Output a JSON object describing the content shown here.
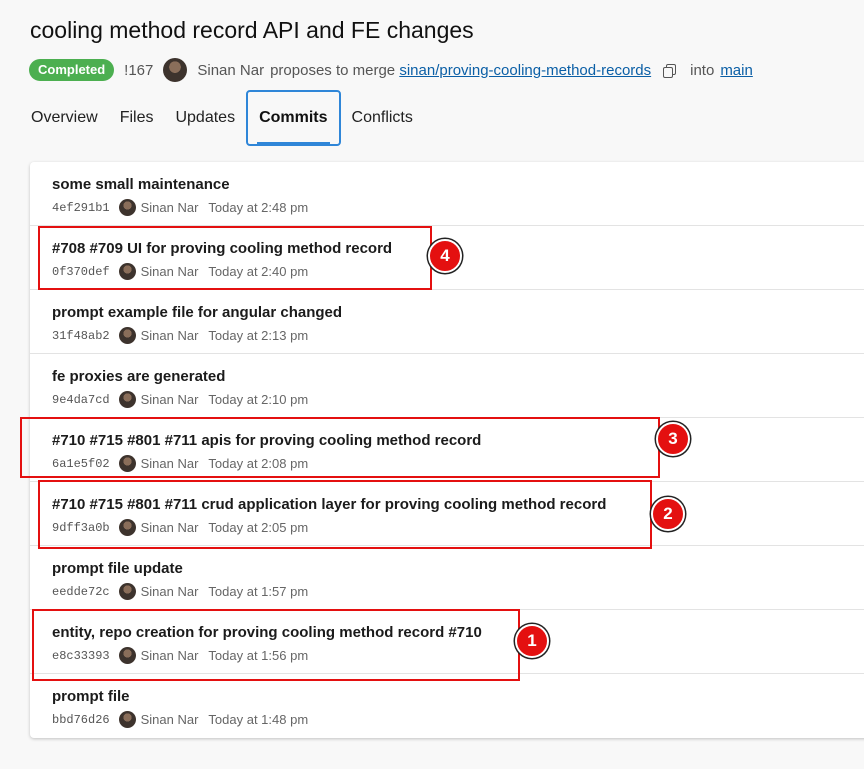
{
  "page": {
    "title": "cooling method record API and FE changes",
    "status": "Completed",
    "pr_id": "!167",
    "author": "Sinan Nar",
    "proposes_text": "proposes to merge",
    "source_branch": "sinan/proving-cooling-method-records",
    "into_text": "into",
    "target_branch": "main"
  },
  "tabs": [
    "Overview",
    "Files",
    "Updates",
    "Commits",
    "Conflicts"
  ],
  "active_tab": "Commits",
  "commits": [
    {
      "message": "some small maintenance",
      "hash": "4ef291b1",
      "author": "Sinan Nar",
      "time": "Today at 2:48 pm"
    },
    {
      "message": "#708 #709 UI for proving cooling method record",
      "hash": "0f370def",
      "author": "Sinan Nar",
      "time": "Today at 2:40 pm"
    },
    {
      "message": "prompt example file for angular changed",
      "hash": "31f48ab2",
      "author": "Sinan Nar",
      "time": "Today at 2:13 pm"
    },
    {
      "message": "fe proxies are generated",
      "hash": "9e4da7cd",
      "author": "Sinan Nar",
      "time": "Today at 2:10 pm"
    },
    {
      "message": "#710 #715 #801 #711 apis for proving cooling method record",
      "hash": "6a1e5f02",
      "author": "Sinan Nar",
      "time": "Today at 2:08 pm"
    },
    {
      "message": "#710 #715 #801 #711 crud application layer for proving cooling method record",
      "hash": "9dff3a0b",
      "author": "Sinan Nar",
      "time": "Today at 2:05 pm"
    },
    {
      "message": "prompt file update",
      "hash": "eedde72c",
      "author": "Sinan Nar",
      "time": "Today at 1:57 pm"
    },
    {
      "message": "entity, repo creation for proving cooling method record #710",
      "hash": "e8c33393",
      "author": "Sinan Nar",
      "time": "Today at 1:56 pm"
    },
    {
      "message": "prompt file",
      "hash": "bbd76d26",
      "author": "Sinan Nar",
      "time": "Today at 1:48 pm"
    }
  ],
  "annotations": {
    "n1": "1",
    "n2": "2",
    "n3": "3",
    "n4": "4"
  },
  "colors": {
    "accent": "#2f86d8",
    "status": "#4caf50",
    "highlight": "#e41010",
    "link": "#0b5fa6"
  }
}
